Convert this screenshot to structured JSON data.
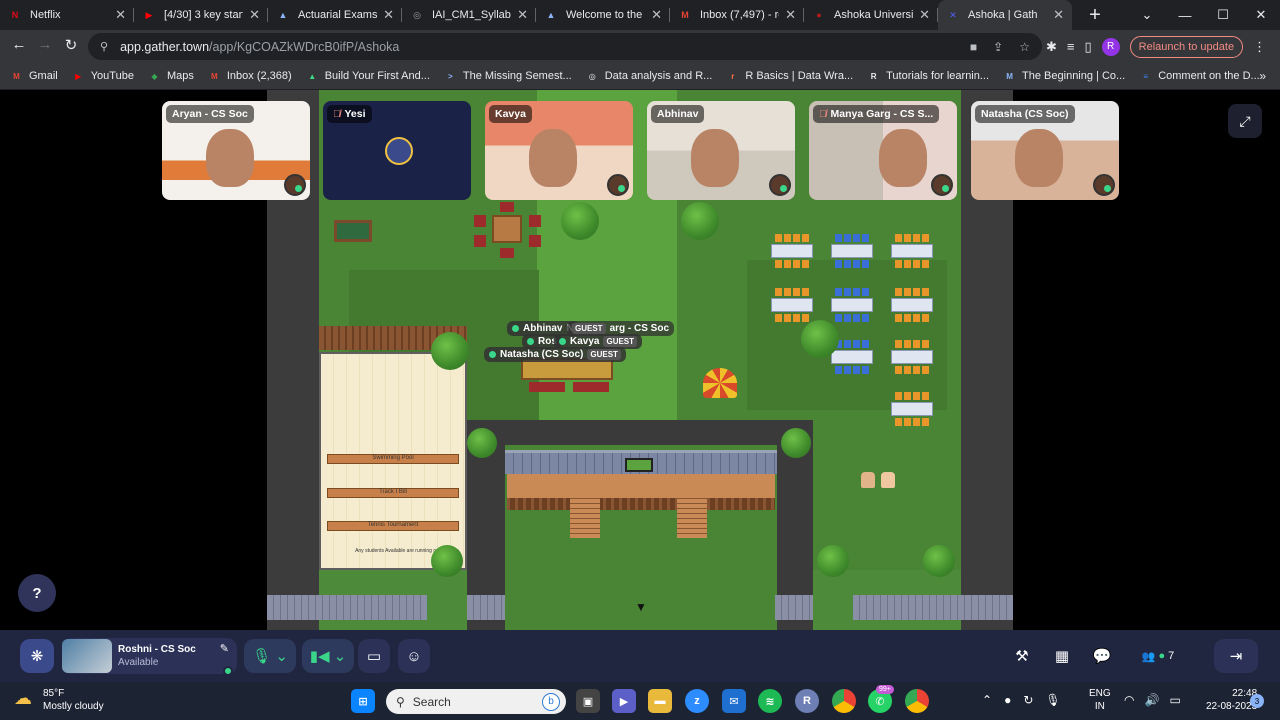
{
  "browser": {
    "tabs": [
      {
        "title": "Netflix",
        "icon": "netflix-icon",
        "color": "#e50914",
        "glyph": "N"
      },
      {
        "title": "[4/30] 3 key starti",
        "icon": "youtube-icon",
        "color": "#ff0000",
        "glyph": "▶"
      },
      {
        "title": "Actuarial Exams |",
        "icon": "triangle-logo-icon",
        "color": "#8ab4f8",
        "glyph": "▲"
      },
      {
        "title": "IAI_CM1_Syllabus",
        "icon": "globe-icon",
        "color": "#9aa0a6",
        "glyph": "◎"
      },
      {
        "title": "Welcome to the I",
        "icon": "triangle-logo-icon",
        "color": "#8ab4f8",
        "glyph": "▲"
      },
      {
        "title": "Inbox (7,497) - ro",
        "icon": "gmail-icon",
        "color": "#ea4335",
        "glyph": "M"
      },
      {
        "title": "Ashoka University",
        "icon": "ashoka-icon",
        "color": "#b71c1c",
        "glyph": "●"
      },
      {
        "title": "Ashoka | Gath",
        "icon": "gather-icon",
        "color": "#4c5ef7",
        "glyph": "✕"
      }
    ],
    "new_tab": "+",
    "url_host": "app.gather.town",
    "url_path": "/app/KgCOAZkWDrcB0ifP/Ashoka",
    "profile_initial": "R",
    "relaunch": "Relaunch to update",
    "bookmarks": [
      {
        "label": "Gmail",
        "icon": "gmail-icon",
        "color": "#ea4335",
        "glyph": "M"
      },
      {
        "label": "YouTube",
        "icon": "youtube-icon",
        "color": "#ff0000",
        "glyph": "▶"
      },
      {
        "label": "Maps",
        "icon": "maps-icon",
        "color": "#34a853",
        "glyph": "◆"
      },
      {
        "label": "Inbox (2,368)",
        "icon": "gmail-icon",
        "color": "#ea4335",
        "glyph": "M"
      },
      {
        "label": "Build Your First And...",
        "icon": "android-icon",
        "color": "#3ddc84",
        "glyph": "▲"
      },
      {
        "label": "The Missing Semest...",
        "icon": "terminal-icon",
        "color": "#8ab4f8",
        "glyph": ">"
      },
      {
        "label": "Data analysis and R...",
        "icon": "globe-icon",
        "color": "#e8eaed",
        "glyph": "◎"
      },
      {
        "label": "R Basics | Data Wra...",
        "icon": "r-icon",
        "color": "#ff7043",
        "glyph": "r"
      },
      {
        "label": "Tutorials for learnin...",
        "icon": "r-logo-icon",
        "color": "#e8eaed",
        "glyph": "R"
      },
      {
        "label": "The Beginning | Co...",
        "icon": "m-logo-icon",
        "color": "#8ab4f8",
        "glyph": "M"
      },
      {
        "label": "Comment on the D...",
        "icon": "docs-icon",
        "color": "#4285f4",
        "glyph": "≡"
      }
    ]
  },
  "gather": {
    "participants": [
      {
        "name": "Aryan - CS Soc",
        "muted": false
      },
      {
        "name": "Yesi",
        "muted": true
      },
      {
        "name": "Kavya",
        "muted": false
      },
      {
        "name": "Abhinav",
        "muted": false
      },
      {
        "name": "Manya Garg - CS S...",
        "muted": true
      },
      {
        "name": "Natasha (CS Soc)",
        "muted": false
      }
    ],
    "map_tags": [
      {
        "name": "Abhinav",
        "guest": "",
        "overlap": "N"
      },
      {
        "name": "",
        "guest": "GUEST",
        "overlap": "arg - CS Soc"
      },
      {
        "name": "Ros",
        "guest": "",
        "overlap": ""
      },
      {
        "name": "Kavya",
        "guest": "GUEST",
        "overlap": ""
      },
      {
        "name": "Natasha (CS Soc)",
        "guest": "GUEST",
        "overlap": ""
      }
    ],
    "signs": [
      "Swimming Pool",
      "Track I Bill",
      "Tennis Tournament",
      "Any students Available are running on"
    ],
    "help": "?",
    "user_name": "Roshni - CS Soc",
    "user_status": "Available",
    "people_count": "7"
  },
  "taskbar": {
    "weather_temp": "85°F",
    "weather_desc": "Mostly cloudy",
    "search": "Search",
    "lang1": "ENG",
    "lang2": "IN",
    "time": "22:48",
    "date": "22-08-2023",
    "whatsapp_badge": "99+",
    "notif_count": "3"
  }
}
